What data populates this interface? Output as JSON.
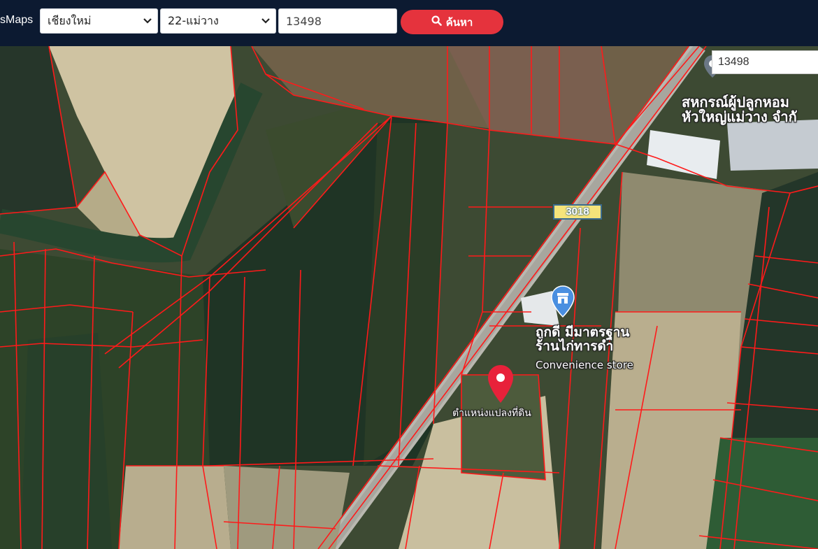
{
  "header": {
    "brand": "sMaps",
    "province_select": "เชียงใหม่",
    "district_select": "22-แม่วาง",
    "parcel_input_value": "13498",
    "search_button_label": "ค้นหา"
  },
  "map": {
    "search_box_value": "13498",
    "road_number": "3018",
    "label_coop": "สหกรณ์ผู้ปลูกหอม\nหัวใหญ่แม่วาง จำกั",
    "label_store_th": "ถูกดี มีมาตรฐาน\nร้านไก่ทารดำ",
    "label_store_en": "Convenience store",
    "label_parcel": "ตำแหน่งแปลงที่ดิน",
    "icons": {
      "pin": "location-pin-icon",
      "store": "shop-icon",
      "search": "magnifier-icon",
      "chevron": "chevron-down-icon"
    },
    "colors": {
      "parcel_lines": "#ff1a1a",
      "pin": "#e8213a",
      "store_pin": "#4a8fe0",
      "header_bg": "#0c1a31",
      "search_button": "#e5333d"
    }
  }
}
